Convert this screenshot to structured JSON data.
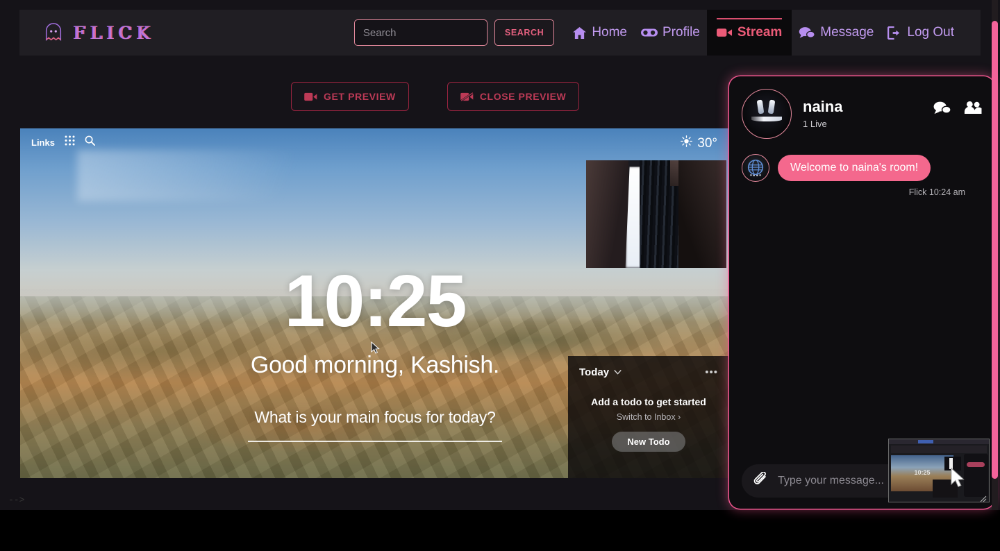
{
  "app": {
    "brand_name": "FLICK",
    "brand_icon": "ghost-icon"
  },
  "navbar": {
    "search": {
      "placeholder": "Search",
      "value": "",
      "button_label": "SEARCH"
    },
    "links": [
      {
        "label": "Home",
        "icon": "home-icon",
        "active": false
      },
      {
        "label": "Profile",
        "icon": "gamepad-icon",
        "active": false
      },
      {
        "label": "Stream",
        "icon": "video-icon",
        "active": true
      },
      {
        "label": "Message",
        "icon": "chat-icon",
        "active": false
      },
      {
        "label": "Log Out",
        "icon": "logout-icon",
        "active": false
      }
    ]
  },
  "toolbar": {
    "get_preview_label": "GET PREVIEW",
    "get_preview_icon": "video-camera-icon",
    "close_preview_label": "CLOSE PREVIEW",
    "close_preview_icon": "video-camera-slash-icon"
  },
  "stream": {
    "topbar": {
      "links_label": "Links",
      "grid_icon": "apps-grid-icon",
      "search_icon": "search-icon"
    },
    "weather": {
      "icon": "sun-icon",
      "temperature": "30°"
    },
    "clock": "10:25",
    "greeting": "Good morning, Kashish.",
    "focus_question": "What is your main focus for today?",
    "todo": {
      "title": "Today",
      "chevron_icon": "chevron-down-icon",
      "menu_icon": "ellipsis-icon",
      "menu_glyph": "•••",
      "empty_text": "Add a todo to get started",
      "switch_text": "Switch to Inbox ›",
      "new_todo_label": "New Todo"
    }
  },
  "chat": {
    "user_name": "naina",
    "live_status": "1 Live",
    "header_icons": [
      {
        "name": "chat-bubbles-icon"
      },
      {
        "name": "people-icon"
      }
    ],
    "messages": [
      {
        "avatar_icon": "globe-icon",
        "text": "Welcome to naina's room!",
        "meta": "Flick 10:24 am"
      }
    ],
    "input": {
      "placeholder": "Type your message...",
      "value": "",
      "attach_icon": "paperclip-icon",
      "send_icon": "send-icon"
    }
  },
  "overlay": {
    "pip_label": "10:25",
    "resize_handle_icon": "resize-handle-icon",
    "cursor_icon": "mouse-cursor-icon"
  },
  "artifacts": {
    "stray_html_comment": "-->"
  },
  "colors": {
    "page_background": "#151318",
    "navbar_background": "#201e23",
    "accent_pink": "#f4688d",
    "accent_purple": "#c29bf0",
    "accent_crimson": "#bd3a56",
    "scrollbar_thumb": "#f4639a"
  }
}
